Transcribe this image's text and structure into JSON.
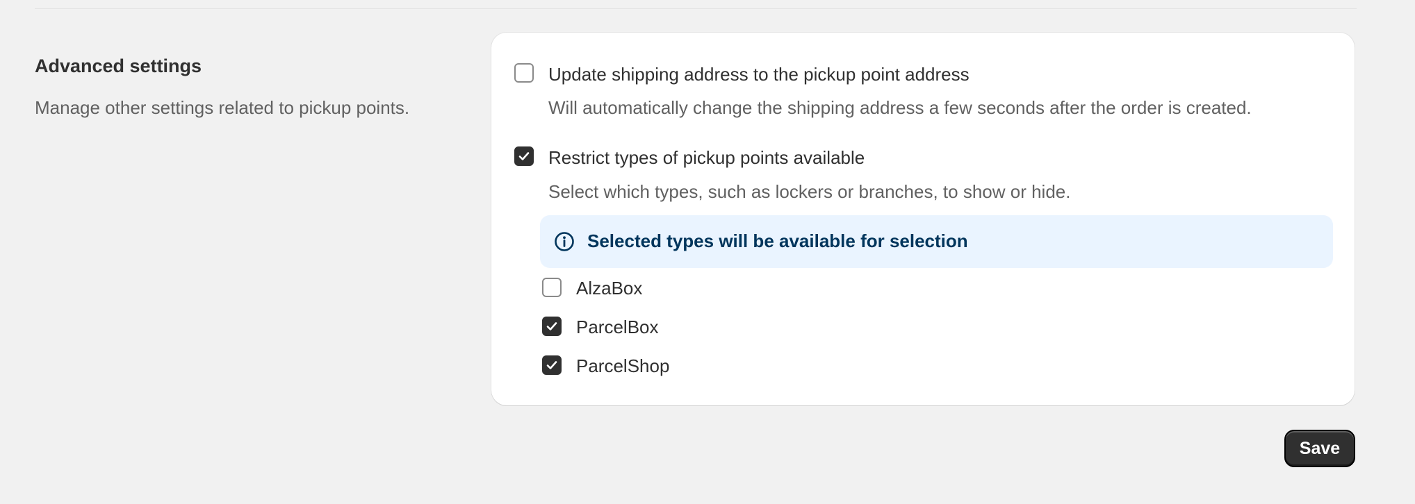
{
  "section": {
    "title": "Advanced settings",
    "description": "Manage other settings related to pickup points."
  },
  "options": {
    "update_address": {
      "label": "Update shipping address to the pickup point address",
      "help": "Will automatically change the shipping address a few seconds after the order is created.",
      "checked": false
    },
    "restrict_types": {
      "label": "Restrict types of pickup points available",
      "help": "Select which types, such as lockers or branches, to show or hide.",
      "checked": true
    }
  },
  "banner": {
    "icon": "info-icon",
    "text": "Selected types will be available for selection",
    "color": "#00355c",
    "background": "#eaf4ff"
  },
  "pickup_types": [
    {
      "label": "AlzaBox",
      "checked": false
    },
    {
      "label": "ParcelBox",
      "checked": true
    },
    {
      "label": "ParcelShop",
      "checked": true
    }
  ],
  "actions": {
    "save_label": "Save"
  },
  "colors": {
    "background": "#f1f1f1",
    "card": "#ffffff",
    "checkbox_checked": "#303030",
    "button": "#303030"
  }
}
